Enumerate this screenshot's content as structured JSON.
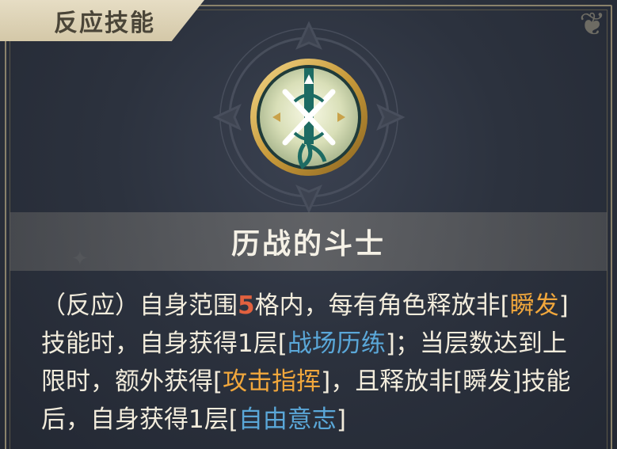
{
  "tab": {
    "label": "反应技能"
  },
  "skill": {
    "name": "历战的斗士",
    "icon": "sword-x-emblem-icon"
  },
  "description": {
    "p1": "（反应）自身范围",
    "range": "5",
    "p2": "格内，每有角色释放非[",
    "k_instant_1": "瞬发",
    "p3": "]技能时，自身获得1层[",
    "k_battle_training": "战场历练",
    "p4": "]；当层数达到上限时，额外获得[",
    "k_attack_command": "攻击指挥",
    "p5": "]，且释放非[瞬发]技能后，自身获得1层[",
    "k_free_will": "自由意志",
    "p6": "]"
  },
  "colors": {
    "highlight_red": "#e2613f",
    "highlight_gold": "#f1a73c",
    "highlight_blue": "#5aa7d8",
    "tab_bg": "#e6ddc4"
  }
}
